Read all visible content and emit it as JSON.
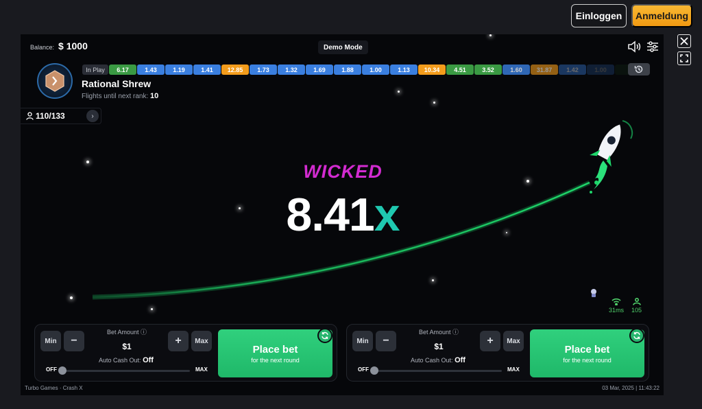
{
  "header": {
    "login_label": "Einloggen",
    "signup_label": "Anmeldung"
  },
  "game": {
    "balance_label": "Balance:",
    "balance_value": "$ 1000",
    "mode_label": "Demo Mode",
    "rank": {
      "name": "Rational Shrew",
      "flights_label": "Flights until next rank:",
      "flights_value": "10"
    },
    "players": "110/133",
    "history_label": "In Play",
    "history": [
      {
        "v": "6.17",
        "c": "green"
      },
      {
        "v": "1.43",
        "c": "blue"
      },
      {
        "v": "1.19",
        "c": "blue"
      },
      {
        "v": "1.41",
        "c": "blue"
      },
      {
        "v": "12.85",
        "c": "orange"
      },
      {
        "v": "1.73",
        "c": "blue"
      },
      {
        "v": "1.32",
        "c": "blue"
      },
      {
        "v": "1.69",
        "c": "blue"
      },
      {
        "v": "1.88",
        "c": "blue"
      },
      {
        "v": "1.00",
        "c": "blue"
      },
      {
        "v": "1.13",
        "c": "blue"
      },
      {
        "v": "10.34",
        "c": "orange"
      },
      {
        "v": "4.51",
        "c": "green"
      },
      {
        "v": "3.52",
        "c": "green"
      },
      {
        "v": "1.60",
        "c": "blue"
      },
      {
        "v": "31.87",
        "c": "orange"
      },
      {
        "v": "1.42",
        "c": "blue"
      },
      {
        "v": "1.00",
        "c": "blue"
      },
      {
        "v": "",
        "c": "green"
      }
    ],
    "callout": "WICKED",
    "multiplier_number": "8.41",
    "multiplier_suffix": "x",
    "ping": "31ms",
    "online": "105",
    "footer_left": "Turbo Games · Crash X",
    "footer_right": "03 Mar, 2025 | 11:43:22"
  },
  "panels": [
    {
      "min_label": "Min",
      "minus_label": "−",
      "plus_label": "+",
      "max_label": "Max",
      "bet_label": "Bet Amount",
      "bet_value": "$1",
      "auto_label": "Auto Cash Out:",
      "auto_value": "Off",
      "slider_off": "OFF",
      "slider_max": "MAX",
      "place_main": "Place bet",
      "place_sub": "for the next round"
    },
    {
      "min_label": "Min",
      "minus_label": "−",
      "plus_label": "+",
      "max_label": "Max",
      "bet_label": "Bet Amount",
      "bet_value": "$1",
      "auto_label": "Auto Cash Out:",
      "auto_value": "Off",
      "slider_off": "OFF",
      "slider_max": "MAX",
      "place_main": "Place bet",
      "place_sub": "for the next round"
    }
  ]
}
